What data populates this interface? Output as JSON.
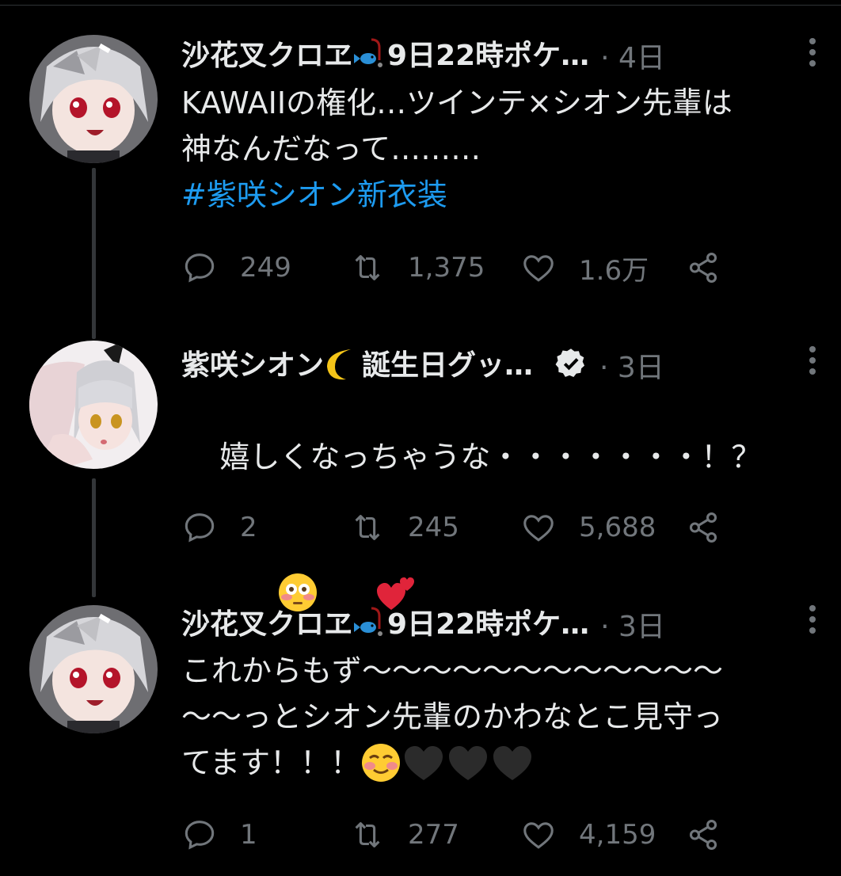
{
  "tweets": [
    {
      "name": "沙花叉クロヱ🎣9日22時ポケ…",
      "name_text": "沙花叉クロヱ",
      "name_suffix": "9日22時ポケ…",
      "time": "· 4日",
      "body": "KAWAIIの権化…ツインテ×シオン先輩は\n神なんだなって………",
      "hashtag": "#紫咲シオン新衣装",
      "replies": "249",
      "retweets": "1,375",
      "likes": "1.6万"
    },
    {
      "name_text": "紫咲シオン",
      "name_suffix": "誕生日グッ…",
      "name_emoji": "crescent-moon",
      "verified": true,
      "time": "· 3日",
      "body": "嬉しくなっちゃうな・・・・・・・！？",
      "body_emojis": [
        "flushed-face-emoji",
        "two-hearts-emoji"
      ],
      "replies": "2",
      "retweets": "245",
      "likes": "5,688"
    },
    {
      "name_text": "沙花叉クロヱ",
      "name_suffix": "9日22時ポケ…",
      "time": "· 3日",
      "body": "これからもず〜〜〜〜〜〜〜〜〜〜〜〜\n〜〜っとシオン先輩のかわなとこ見守っ\nてます！！！",
      "body_emojis": [
        "smiling-face-emoji",
        "black-heart-emoji",
        "black-heart-emoji",
        "black-heart-emoji"
      ],
      "replies": "1",
      "retweets": "277",
      "likes": "4,159"
    }
  ],
  "colors": {
    "background": "#000000",
    "text": "#e7e9ea",
    "muted": "#71767b",
    "link": "#1d9bf0",
    "thread_line": "#333639"
  }
}
